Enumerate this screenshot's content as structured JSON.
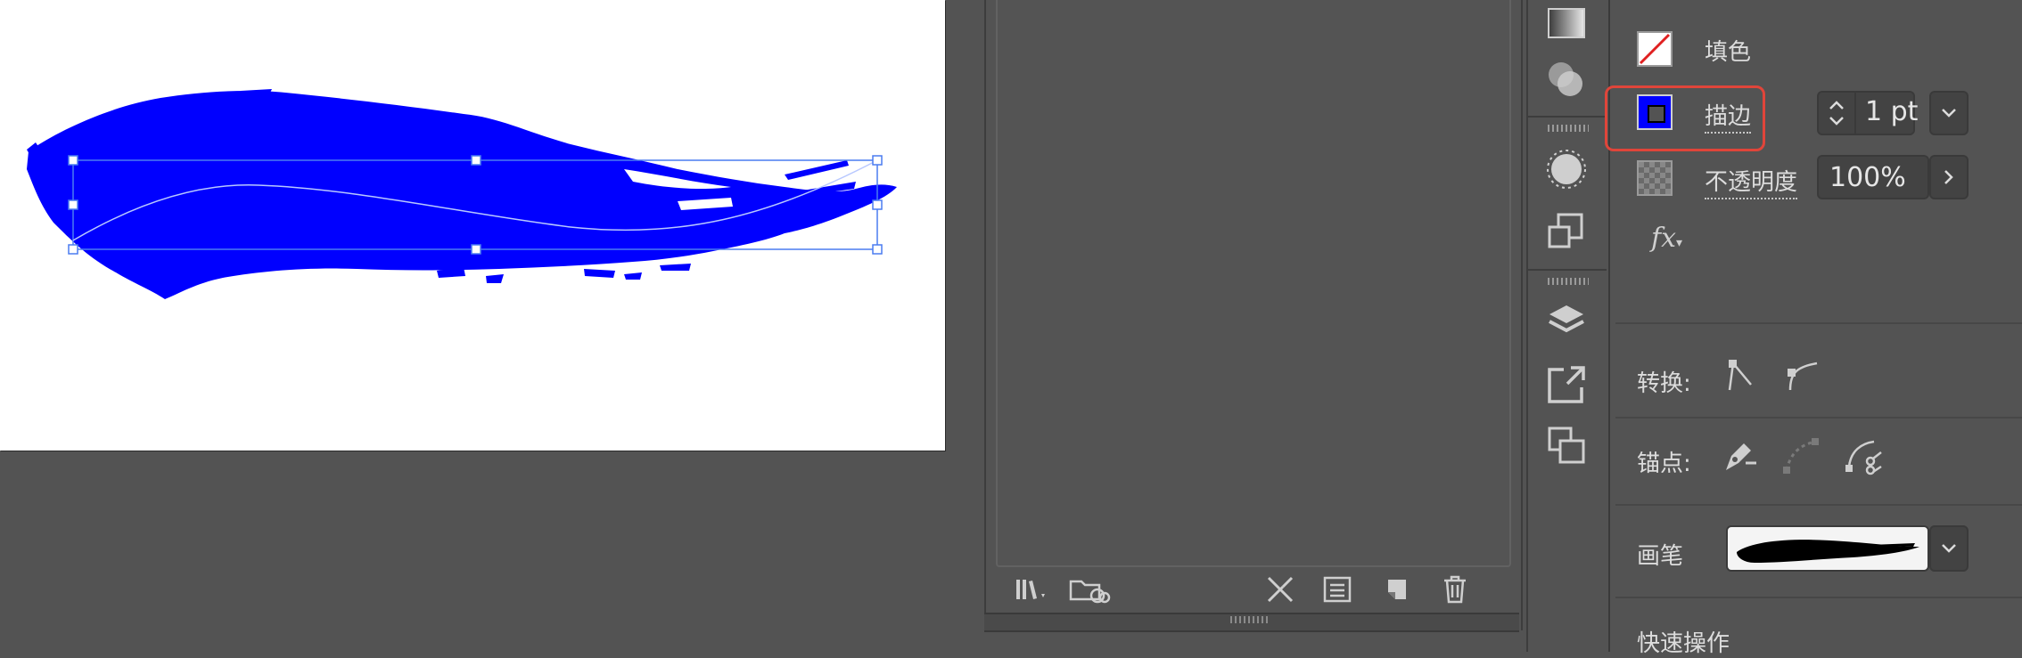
{
  "appearance": {
    "fill_label": "填色",
    "stroke_label": "描边",
    "stroke_weight": "1 pt",
    "opacity_label": "不透明度",
    "opacity_value": "100%",
    "fx_label": "fx"
  },
  "convert": {
    "label": "转换:"
  },
  "anchor": {
    "label": "锚点:"
  },
  "brush": {
    "label": "画笔"
  },
  "quick_actions": {
    "label": "快速操作"
  },
  "colors": {
    "artwork_fill": "#0000ff",
    "selection": "#4a7cf0",
    "highlight": "#e0453a",
    "panel_bg": "#535353"
  },
  "icons": {
    "strip": [
      "gradient-icon",
      "transparency-icon",
      "appearance-icon",
      "transform-icon",
      "layers-icon",
      "export-icon",
      "artboards-icon"
    ],
    "mid_toolbar": [
      "libraries-icon",
      "cloud-libraries-icon",
      "break-link-icon",
      "brush-options-icon",
      "new-brush-icon",
      "delete-icon"
    ]
  }
}
